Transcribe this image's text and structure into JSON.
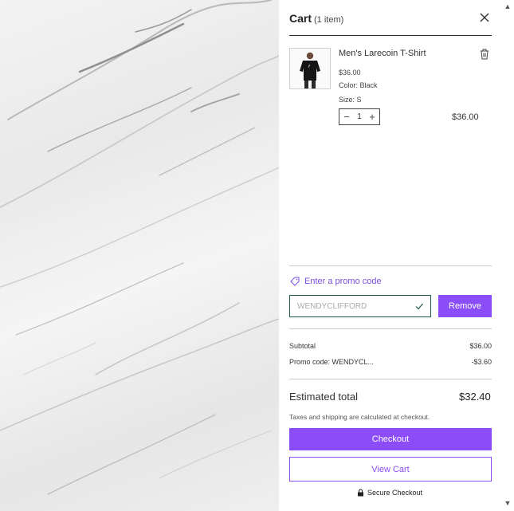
{
  "header": {
    "title": "Cart",
    "count": "(1 item)",
    "close_icon": "close-icon"
  },
  "item": {
    "name": "Men's Larecoin T-Shirt",
    "price": "$36.00",
    "color": "Color: Black",
    "size": "Size: S",
    "quantity": "1",
    "line_total": "$36.00",
    "decrease_icon": "minus-icon",
    "increase_icon": "plus-icon",
    "delete_icon": "trash-icon"
  },
  "promo": {
    "link_label": "Enter a promo code",
    "code": "WENDYCLIFFORD",
    "remove_label": "Remove",
    "tag_icon": "tag-icon",
    "check_icon": "check-icon"
  },
  "summary": {
    "subtotal_label": "Subtotal",
    "subtotal_value": "$36.00",
    "promo_label": "Promo code: WENDYCL...",
    "promo_value": "-$3.60",
    "estimated_label": "Estimated total",
    "estimated_value": "$32.40",
    "tax_note": "Taxes and shipping are calculated at checkout."
  },
  "actions": {
    "checkout_label": "Checkout",
    "view_cart_label": "View Cart",
    "secure_label": "Secure Checkout",
    "lock_icon": "lock-icon"
  },
  "colors": {
    "accent": "#8a4df8",
    "promo_border": "#1e5a4a"
  }
}
